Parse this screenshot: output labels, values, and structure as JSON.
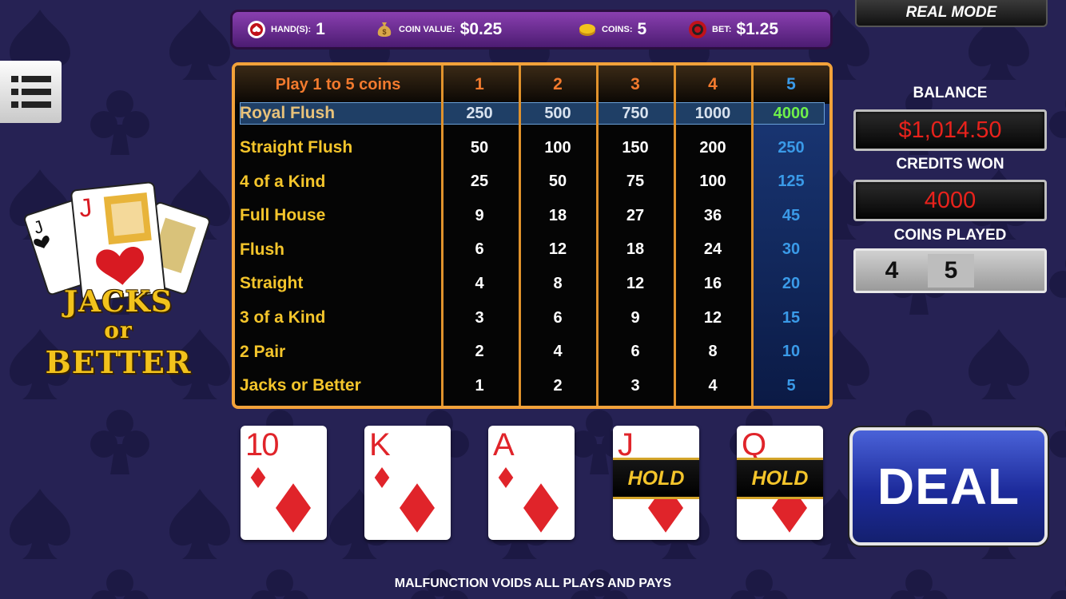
{
  "status_bar": {
    "hands_label": "HAND(S):",
    "hands_value": "1",
    "coin_value_label": "COIN VALUE:",
    "coin_value": "$0.25",
    "coins_label": "COINS:",
    "coins_value": "5",
    "bet_label": "BET:",
    "bet_value": "$1.25"
  },
  "mode_label": "REAL MODE",
  "logo": {
    "line1": "JACKS",
    "line2": "or",
    "line3": "BETTER"
  },
  "paytable": {
    "header_label": "Play 1 to 5 coins",
    "columns": [
      "1",
      "2",
      "3",
      "4",
      "5"
    ],
    "rows": [
      {
        "name": "Royal Flush",
        "values": [
          "250",
          "500",
          "750",
          "1000",
          "4000"
        ]
      },
      {
        "name": "Straight Flush",
        "values": [
          "50",
          "100",
          "150",
          "200",
          "250"
        ]
      },
      {
        "name": "4 of a Kind",
        "values": [
          "25",
          "50",
          "75",
          "100",
          "125"
        ]
      },
      {
        "name": "Full House",
        "values": [
          "9",
          "18",
          "27",
          "36",
          "45"
        ]
      },
      {
        "name": "Flush",
        "values": [
          "6",
          "12",
          "18",
          "24",
          "30"
        ]
      },
      {
        "name": "Straight",
        "values": [
          "4",
          "8",
          "12",
          "16",
          "20"
        ]
      },
      {
        "name": "3 of a Kind",
        "values": [
          "3",
          "6",
          "9",
          "12",
          "15"
        ]
      },
      {
        "name": "2 Pair",
        "values": [
          "2",
          "4",
          "6",
          "8",
          "10"
        ]
      },
      {
        "name": "Jacks or Better",
        "values": [
          "1",
          "2",
          "3",
          "4",
          "5"
        ]
      }
    ]
  },
  "panel": {
    "balance_label": "BALANCE",
    "balance_value": "$1,014.50",
    "credits_won_label": "CREDITS WON",
    "credits_won_value": "4000",
    "coins_played_label": "COINS PLAYED",
    "coins_played_values": [
      "4",
      "5"
    ]
  },
  "hand": [
    {
      "rank": "10",
      "suit": "diamonds",
      "held": false
    },
    {
      "rank": "K",
      "suit": "diamonds",
      "held": false
    },
    {
      "rank": "A",
      "suit": "diamonds",
      "held": false
    },
    {
      "rank": "J",
      "suit": "diamonds",
      "held": true
    },
    {
      "rank": "Q",
      "suit": "diamonds",
      "held": true
    }
  ],
  "hold_label": "HOLD",
  "deal_label": "DEAL",
  "footer": "MALFUNCTION VOIDS ALL PLAYS AND PAYS",
  "colors": {
    "background": "#262254",
    "paytable_border": "#f2a23a",
    "paytable_name": "#f4c52b",
    "column5_value": "#3a9ae8",
    "royal_max": "#6ff04a",
    "balance_text": "#e8221c",
    "deal_button": "#1c2a9a",
    "card_red": "#e0242a"
  }
}
